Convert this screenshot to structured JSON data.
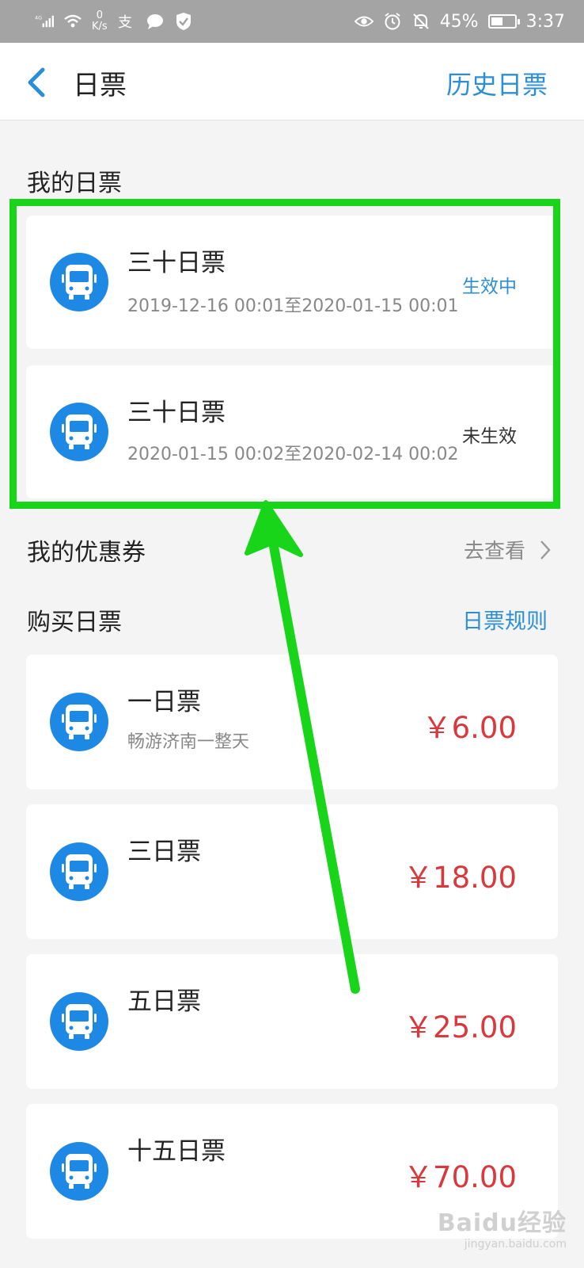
{
  "status_bar": {
    "network": "4G",
    "speed_value": "0",
    "speed_unit": "K/s",
    "battery": "45%",
    "time": "3:37"
  },
  "header": {
    "title": "日票",
    "history_label": "历史日票"
  },
  "my_tickets": {
    "title": "我的日票",
    "items": [
      {
        "name": "三十日票",
        "period": "2019-12-16 00:01至2020-01-15 00:01",
        "status": "生效中"
      },
      {
        "name": "三十日票",
        "period": "2020-01-15 00:02至2020-02-14 00:02",
        "status": "未生效"
      }
    ]
  },
  "coupons": {
    "title": "我的优惠券",
    "link": "去查看"
  },
  "purchase": {
    "title": "购买日票",
    "rules_label": "日票规则",
    "items": [
      {
        "name": "一日票",
        "desc": "畅游济南一整天",
        "price": "￥6.00"
      },
      {
        "name": "三日票",
        "price": "￥18.00"
      },
      {
        "name": "五日票",
        "price": "￥25.00"
      },
      {
        "name": "十五日票",
        "price": "￥70.00"
      }
    ]
  },
  "watermark": {
    "main": "Baidu经验",
    "sub": "jingyan.baidu.com"
  },
  "colors": {
    "accent": "#2c8ed6",
    "price": "#d9393c",
    "icon_bg": "#1e88e5",
    "annotation": "#19d519"
  },
  "icons": [
    "back-arrow-icon",
    "bus-icon",
    "chevron-right-icon",
    "signal-icon",
    "wifi-icon",
    "alipay-icon",
    "message-icon",
    "shield-icon",
    "eye-icon",
    "alarm-icon",
    "mute-icon",
    "battery-icon"
  ]
}
